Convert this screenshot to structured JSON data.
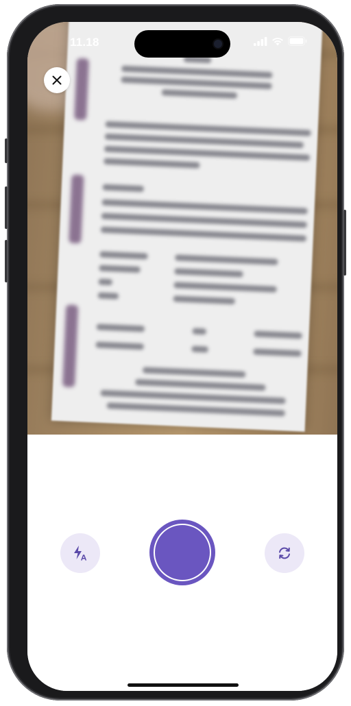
{
  "status_bar": {
    "time": "11.18",
    "icons": [
      "cellular-signal-icon",
      "wifi-icon",
      "battery-icon"
    ]
  },
  "camera": {
    "close_icon": "close-icon",
    "flash_icon": "flash-auto-icon",
    "flip_icon": "switch-camera-icon",
    "shutter_icon": "shutter-button"
  },
  "colors": {
    "accent": "#6A56C0",
    "control_bg": "#ECE8F7",
    "panel_bg": "#FFFFFF"
  }
}
